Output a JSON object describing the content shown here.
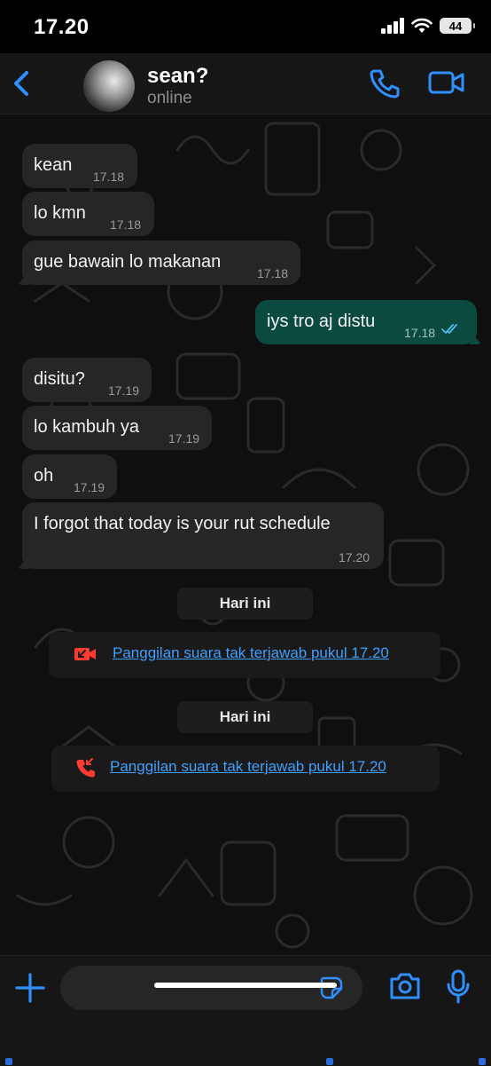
{
  "status_bar": {
    "time": "17.20",
    "battery": "44"
  },
  "header": {
    "name": "sean?",
    "status": "online"
  },
  "messages": [
    {
      "text": "kean",
      "time": "17.18"
    },
    {
      "text": "lo kmn",
      "time": "17.18"
    },
    {
      "text": "gue bawain lo makanan",
      "time": "17.18"
    },
    {
      "text": "iys tro aj distu",
      "time": "17.18"
    },
    {
      "text": "disitu?",
      "time": "17.19"
    },
    {
      "text": "lo kambuh ya",
      "time": "17.19"
    },
    {
      "text": "oh",
      "time": "17.19"
    },
    {
      "text": "I forgot that today is your rut schedule",
      "time": "17.20"
    }
  ],
  "system": [
    {
      "date": "Hari ini",
      "call": "Panggilan suara tak terjawab pukul 17.20"
    },
    {
      "date": "Hari ini",
      "call": "Panggilan suara tak terjawab pukul 17.20"
    }
  ],
  "colors": {
    "accent": "#3ea0ff",
    "outgoing_bubble": "#0b4a3f",
    "incoming_bubble": "#262626",
    "missed_call": "#ff3b30"
  },
  "icons": [
    "back-icon",
    "phone-icon",
    "video-icon",
    "double-check-icon",
    "missed-video-call-icon",
    "missed-voice-call-icon",
    "plus-icon",
    "sticker-icon",
    "camera-icon",
    "mic-icon"
  ]
}
